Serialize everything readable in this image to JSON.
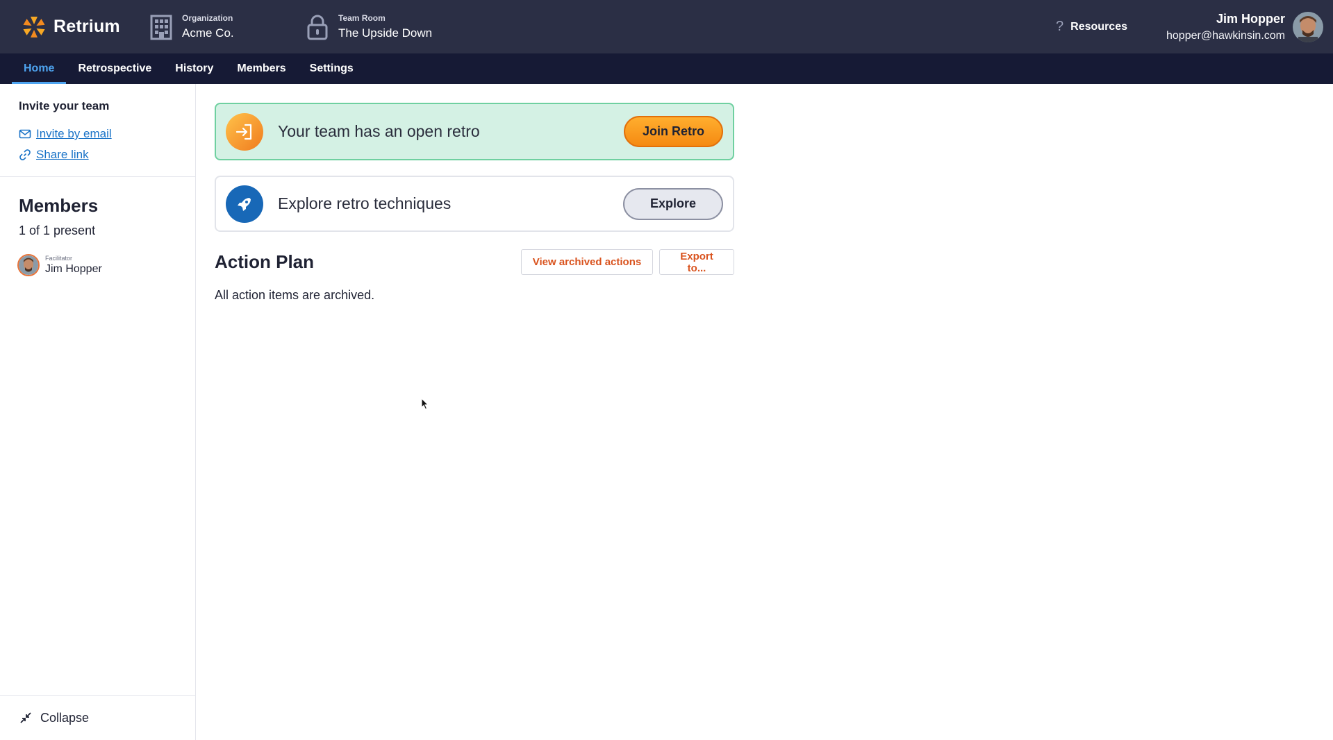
{
  "brand": {
    "name": "Retrium"
  },
  "header": {
    "organization": {
      "label": "Organization",
      "value": "Acme Co."
    },
    "team_room": {
      "label": "Team Room",
      "value": "The Upside Down"
    },
    "resources": "Resources",
    "user": {
      "name": "Jim Hopper",
      "email": "hopper@hawkinsin.com"
    }
  },
  "nav": {
    "tabs": [
      {
        "label": "Home",
        "active": true
      },
      {
        "label": "Retrospective"
      },
      {
        "label": "History"
      },
      {
        "label": "Members"
      },
      {
        "label": "Settings"
      }
    ]
  },
  "sidebar": {
    "invite": {
      "title": "Invite your team",
      "email_link": "Invite by email",
      "share_link": "Share link"
    },
    "members": {
      "title": "Members",
      "count": "1 of 1 present",
      "list": [
        {
          "role": "Facilitator",
          "name": "Jim Hopper"
        }
      ]
    },
    "collapse": "Collapse"
  },
  "main": {
    "retro_card": {
      "text": "Your team has an open retro",
      "button": "Join Retro"
    },
    "explore_card": {
      "text": "Explore retro techniques",
      "button": "Explore"
    },
    "action_plan": {
      "title": "Action Plan",
      "view_archived": "View archived actions",
      "export": "Export to...",
      "empty": "All action items are archived."
    }
  },
  "colors": {
    "header_bg": "#2b2f45",
    "nav_bg": "#161a35",
    "active_tab": "#4ea4f0",
    "retro_card_bg": "#d4f1e4",
    "join_button": "#f5a01e",
    "link": "#1a73c7",
    "outline_button_text": "#d9531e"
  }
}
